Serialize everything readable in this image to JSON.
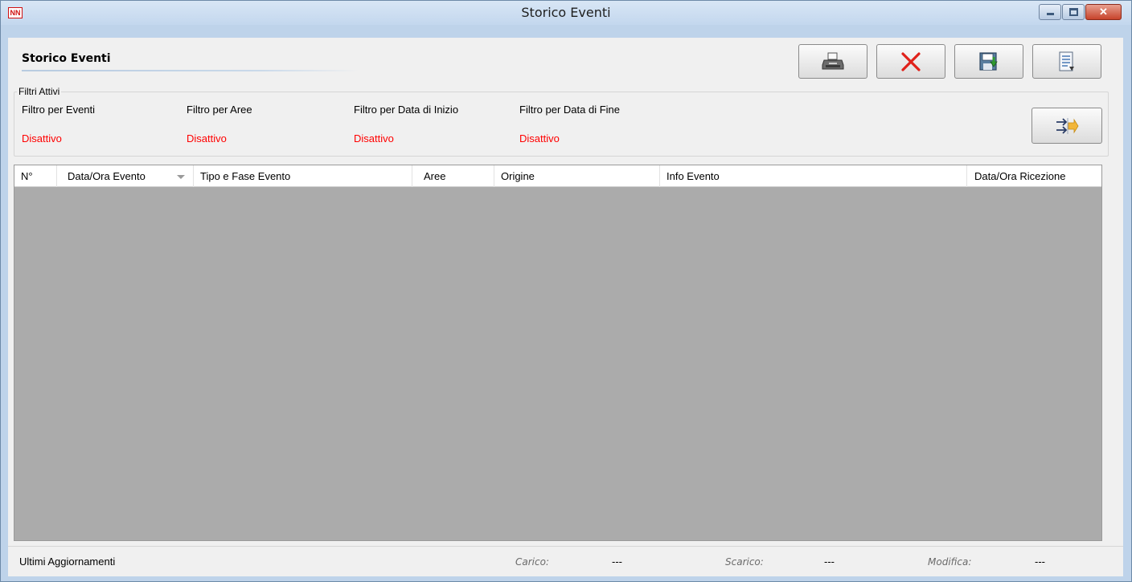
{
  "window": {
    "title": "Storico Eventi",
    "app_icon_text": "NN",
    "controls": {
      "minimize": "minimize-icon",
      "maximize": "maximize-icon",
      "close": "close-icon"
    }
  },
  "header": {
    "title": "Storico Eventi"
  },
  "toolbar": {
    "buttons": [
      {
        "name": "print-button",
        "icon": "printer-icon"
      },
      {
        "name": "delete-button",
        "icon": "red-x-icon"
      },
      {
        "name": "save-button",
        "icon": "save-disk-icon"
      },
      {
        "name": "report-button",
        "icon": "document-icon"
      }
    ]
  },
  "filters": {
    "legend": "Filtri Attivi",
    "items": [
      {
        "label": "Filtro per Eventi",
        "value": "Disattivo"
      },
      {
        "label": "Filtro per Aree",
        "value": "Disattivo"
      },
      {
        "label": "Filtro per Data di Inizio",
        "value": "Disattivo"
      },
      {
        "label": "Filtro per Data di Fine",
        "value": "Disattivo"
      }
    ],
    "apply_button_icon": "filter-apply-icon",
    "value_color": "#ff0000"
  },
  "table": {
    "columns": [
      "N°",
      "Data/Ora Evento",
      "Tipo e Fase Evento",
      "Aree",
      "Origine",
      "Info Evento",
      "Data/Ora Ricezione"
    ],
    "sorted_column": "Data/Ora Evento",
    "sort_direction": "descending",
    "rows": [],
    "empty_background": "#ababab"
  },
  "status": {
    "title": "Ultimi Aggiornamenti",
    "carico_label": "Carico:",
    "carico_value": "---",
    "scarico_label": "Scarico:",
    "scarico_value": "---",
    "modifica_label": "Modifica:",
    "modifica_value": "---"
  }
}
